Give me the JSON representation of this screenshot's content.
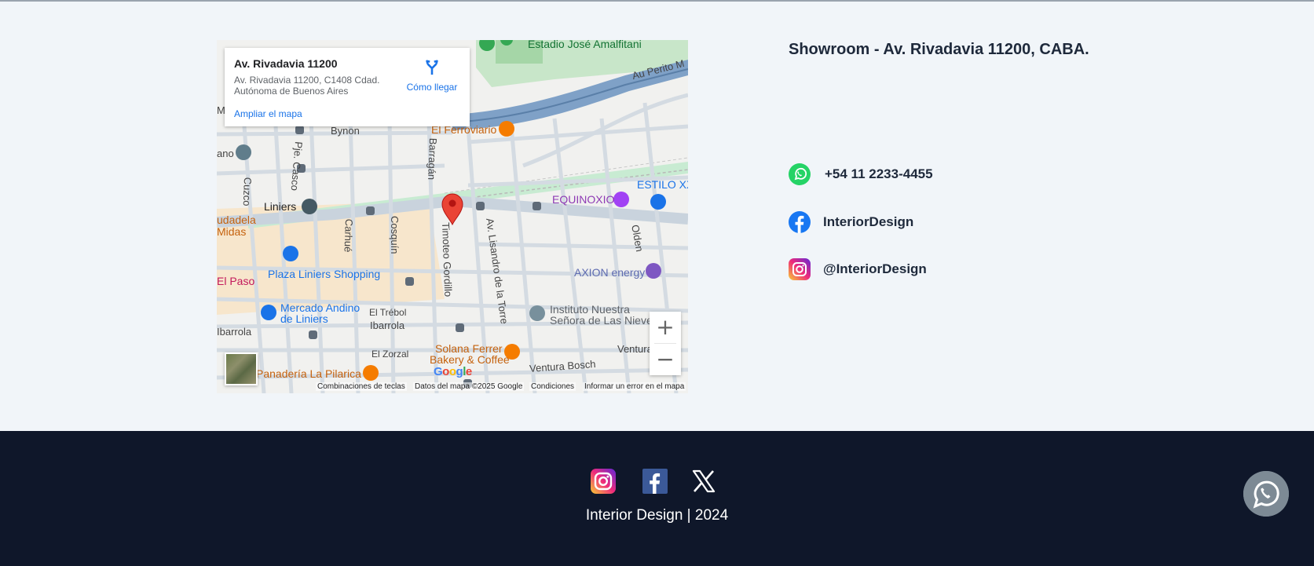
{
  "map": {
    "info_title": "Av. Rivadavia 11200",
    "info_address": "Av. Rivadavia 11200, C1408 Cdad. Autónoma de Buenos Aires",
    "enlarge_link": "Ampliar el mapa",
    "directions_label": "Cómo llegar",
    "zoom_in": "+",
    "zoom_out": "−",
    "google_logo": "Google",
    "attribution": {
      "shortcuts": "Combinaciones de teclas",
      "data": "Datos del mapa ©2025 Google",
      "terms": "Condiciones",
      "report": "Informar un error en el mapa"
    },
    "labels": {
      "stadium": "Estadio José Amalfitani",
      "perito": "Au Perito M",
      "bynon": "Bynon",
      "ferroviario": "El Ferroviario",
      "casco": "Pje. Casco",
      "barragan": "Barragán",
      "ano": "ano",
      "cuzco": "Cuzco",
      "estilo": "ESTILO XX",
      "liniers": "Liniers",
      "equinoxio": "EQUINOXIO",
      "ciudadela": "udadela",
      "midas": "Midas",
      "carhue": "Carhué",
      "cosquin": "Cosquín",
      "timoteo": "Timoteo Gordillo",
      "lisandro": "Av. Lisandro de la Torre",
      "olden": "Olden",
      "plaza": "Plaza Liniers Shopping",
      "axion": "AXION energy",
      "elpaso": "El Paso",
      "mercado1": "Mercado Andino",
      "mercado2": "de Liniers",
      "trebol": "El Trébol",
      "ibarrola1": "Ibarrola",
      "ibarrola2": "Ibarrola",
      "instituto1": "Instituto Nuestra",
      "instituto2": "Señora de Las Nieve",
      "ventura": "Ventura",
      "zorzal": "El Zorzal",
      "solana1": "Solana Ferrer",
      "solana2": "Bakery & Coffee",
      "panaderia": "Panadería La Pilarica",
      "bosch": "Ventura Bosch",
      "mstub": "M"
    }
  },
  "contact": {
    "showroom": "Showroom - Av. Rivadavia 11200, CABA.",
    "phone": "+54 11 2233-4455",
    "facebook": "InteriorDesign",
    "instagram": "@InteriorDesign"
  },
  "footer": {
    "copyright": "Interior Design | 2024",
    "x_glyph": "𝕏"
  },
  "colors": {
    "page_bg": "#f1f5f9",
    "footer_bg": "#0f172a",
    "whatsapp": "#25d366",
    "facebook": "#1877f2",
    "map_link": "#1a73e8"
  }
}
